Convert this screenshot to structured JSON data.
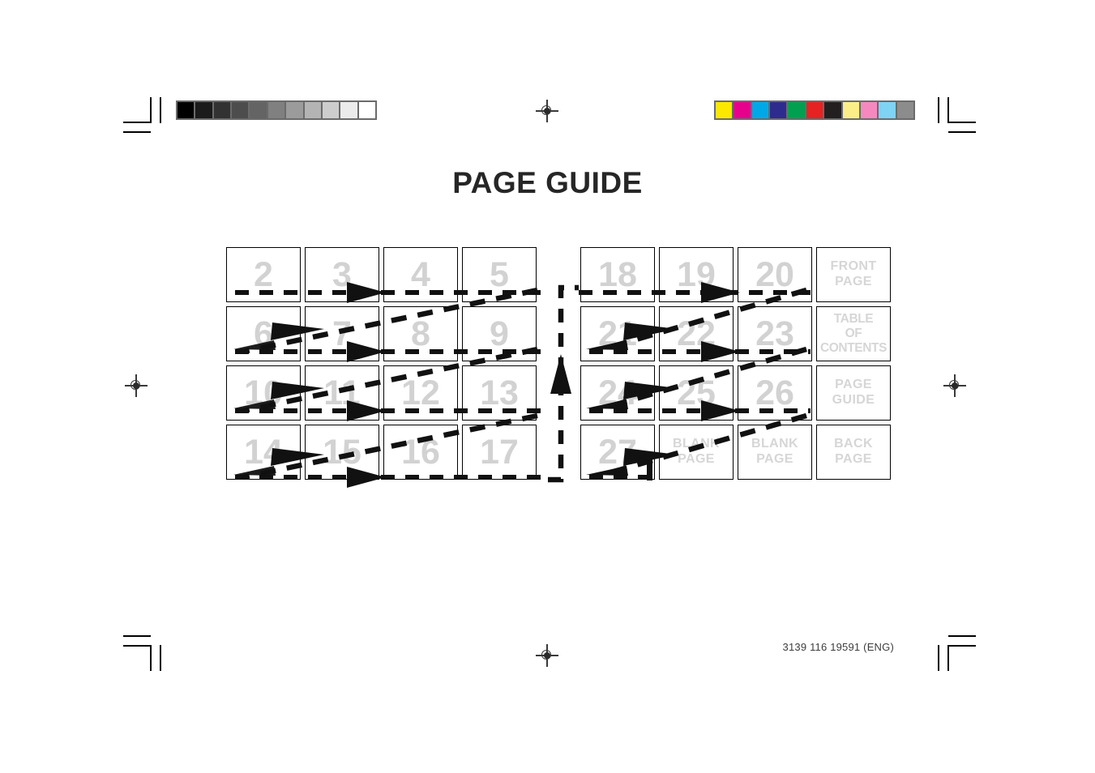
{
  "document": {
    "title": "PAGE GUIDE",
    "footer_code": "3139 116 19591 (ENG)"
  },
  "calibration": {
    "grayscale_bar": {
      "name": "grayscale-step-wedge",
      "swatches": [
        "#000000",
        "#1b1b1b",
        "#323232",
        "#4d4d4d",
        "#646464",
        "#808080",
        "#9b9b9b",
        "#b4b4b4",
        "#cdcdcd",
        "#ebebeb",
        "#ffffff"
      ]
    },
    "color_bar": {
      "name": "process-color-bar",
      "swatches": [
        "#fbe700",
        "#e6008c",
        "#00a8e8",
        "#2e2b8f",
        "#00a050",
        "#e62222",
        "#231f20",
        "#fbee88",
        "#f589bf",
        "#7fd3f5",
        "#8c8c8c"
      ]
    },
    "registration_marks": 4,
    "crop_marks": 4
  },
  "left_grid": {
    "name": "page-grid-left",
    "columns": 4,
    "rows": 4,
    "cells": [
      {
        "type": "number",
        "text": "2"
      },
      {
        "type": "number",
        "text": "3"
      },
      {
        "type": "number",
        "text": "4"
      },
      {
        "type": "number",
        "text": "5"
      },
      {
        "type": "number",
        "text": "6"
      },
      {
        "type": "number",
        "text": "7"
      },
      {
        "type": "number",
        "text": "8"
      },
      {
        "type": "number",
        "text": "9"
      },
      {
        "type": "number",
        "text": "10"
      },
      {
        "type": "number",
        "text": "11"
      },
      {
        "type": "number",
        "text": "12"
      },
      {
        "type": "number",
        "text": "13"
      },
      {
        "type": "number",
        "text": "14"
      },
      {
        "type": "number",
        "text": "15"
      },
      {
        "type": "number",
        "text": "16"
      },
      {
        "type": "number",
        "text": "17"
      }
    ]
  },
  "right_grid": {
    "name": "page-grid-right",
    "columns": 4,
    "rows": 4,
    "cells": [
      {
        "type": "number",
        "text": "18"
      },
      {
        "type": "number",
        "text": "19"
      },
      {
        "type": "number",
        "text": "20"
      },
      {
        "type": "label",
        "text": "FRONT\nPAGE"
      },
      {
        "type": "number",
        "text": "21"
      },
      {
        "type": "number",
        "text": "22"
      },
      {
        "type": "number",
        "text": "23"
      },
      {
        "type": "label",
        "text": "TABLE\nOF\nCONTENTS",
        "squeeze": true
      },
      {
        "type": "number",
        "text": "24"
      },
      {
        "type": "number",
        "text": "25"
      },
      {
        "type": "number",
        "text": "26"
      },
      {
        "type": "label",
        "text": "PAGE\nGUIDE"
      },
      {
        "type": "number",
        "text": "27"
      },
      {
        "type": "label",
        "text": "BLANK\nPAGE"
      },
      {
        "type": "label",
        "text": "BLANK\nPAGE"
      },
      {
        "type": "label",
        "text": "BACK\nPAGE"
      }
    ]
  },
  "flow": {
    "name": "imposition-flow-arrows",
    "style": "dashed-black",
    "description": "Dashed reading-order arrows running left-to-right across each row and diagonally back, with a vertical riser linking the bottom of the left grid to the top of the right grid."
  }
}
